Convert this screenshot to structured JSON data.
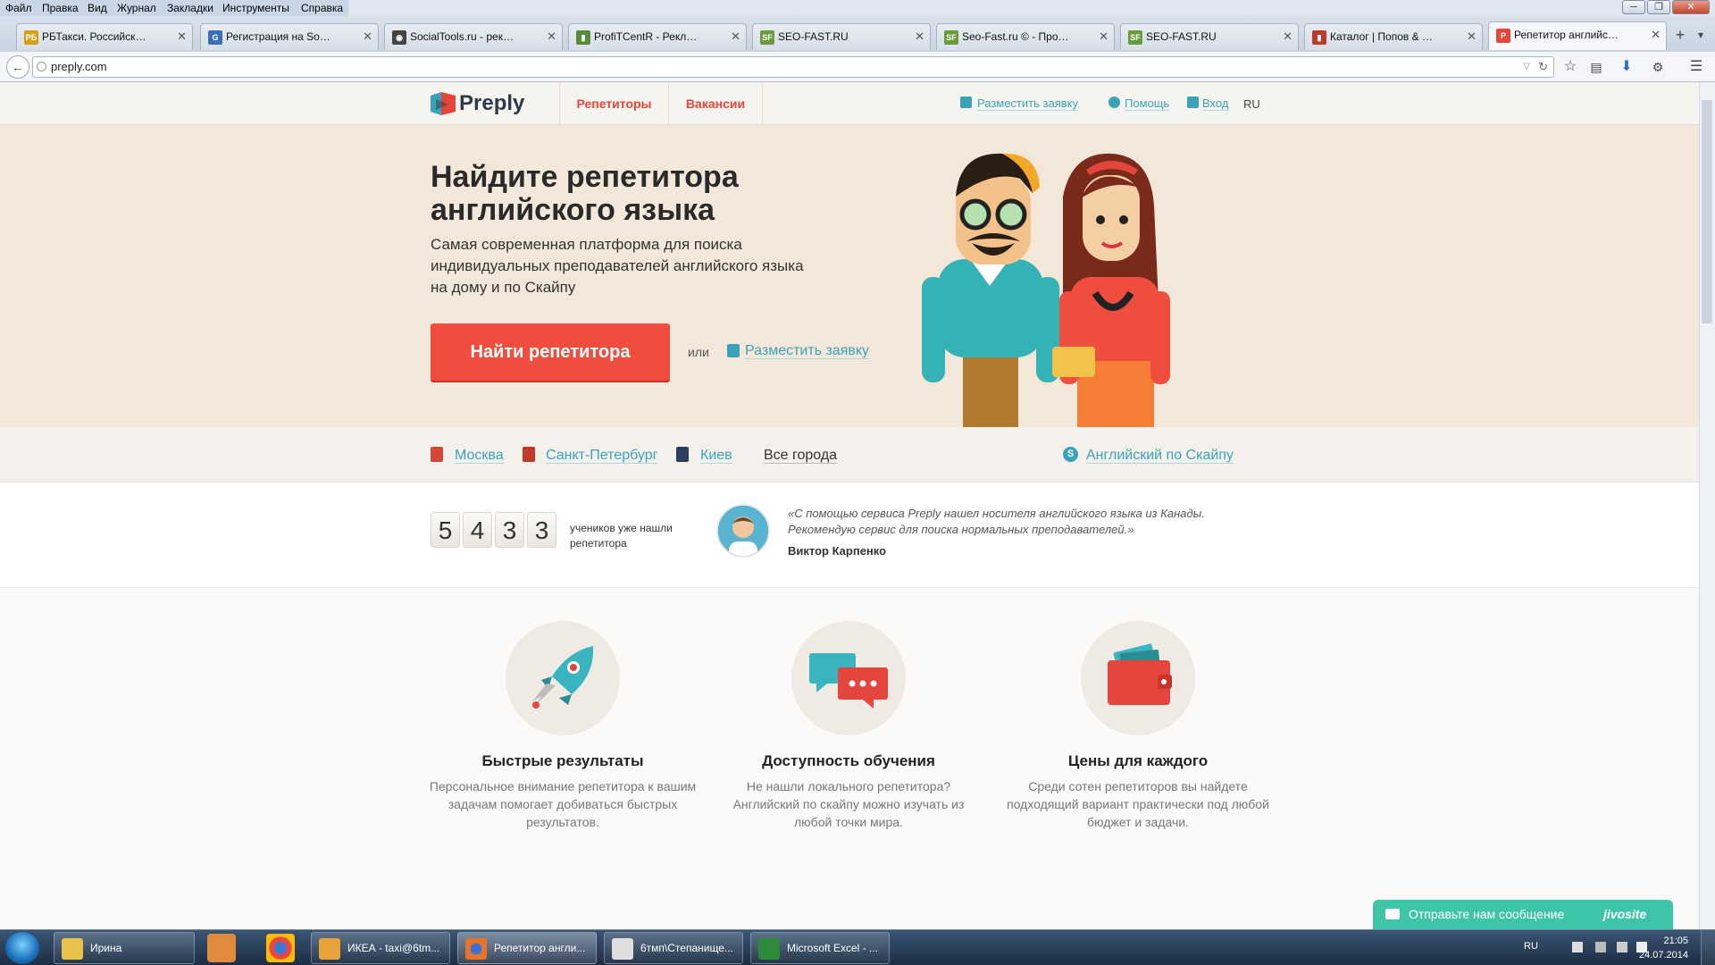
{
  "browser": {
    "menu": [
      "Файл",
      "Правка",
      "Вид",
      "Журнал",
      "Закладки",
      "Инструменты",
      "Справка"
    ],
    "tabs": [
      {
        "title": "РБТакси. Российская Би...",
        "color": "#d4a017",
        "fav": "РБ"
      },
      {
        "title": "Регистрация на SocialTo...",
        "color": "#3b6fb6",
        "fav": "G"
      },
      {
        "title": "SocialTools.ru - реклама ...",
        "color": "#444",
        "fav": "◉"
      },
      {
        "title": "ProfiTCentR - Рекламное ...",
        "color": "#5a8a3a",
        "fav": "▮"
      },
      {
        "title": "SEO-FAST.RU",
        "color": "#6a9b3a",
        "fav": "SF"
      },
      {
        "title": "Seo-Fast.ru © - Просмот...",
        "color": "#6a9b3a",
        "fav": "SF"
      },
      {
        "title": "SEO-FAST.RU",
        "color": "#6a9b3a",
        "fav": "SF"
      },
      {
        "title": "Каталог | Попов & Партн...",
        "color": "#c0392b",
        "fav": "▮"
      },
      {
        "title": "Репетитор английского я...",
        "color": "#e4463d",
        "fav": "P"
      }
    ],
    "url": "preply.com"
  },
  "site": {
    "logo": "Preply",
    "nav": {
      "tutors": "Репетиторы",
      "jobs": "Вакансии"
    },
    "header_links": {
      "post": "Разместить заявку",
      "help": "Помощь",
      "login": "Вход",
      "lang": "RU"
    },
    "hero": {
      "title": "Найдите репетитора английского языка",
      "subtitle": "Самая современная платформа для поиска индивидуальных преподавателей английского языка на дому и по Скайпу",
      "cta": "Найти репетитора",
      "or": "или",
      "post_link": "Разместить заявку"
    },
    "cities": [
      "Москва",
      "Санкт-Петербург",
      "Киев"
    ],
    "all_cities": "Все города",
    "skype_link": "Английский по Скайпу",
    "stats": {
      "digits": [
        "5",
        "4",
        "3",
        "3"
      ],
      "label": "учеников уже нашли репетитора"
    },
    "testimonial": {
      "quote": "«С помощью сервиса Preply нашел носителя английского языка из Канады. Рекомендую сервис для поиска нормальных преподавателей.»",
      "author": "Виктор Карпенко"
    },
    "features": [
      {
        "title": "Быстрые результаты",
        "desc": "Персональное внимание репетитора к вашим задачам помогает добиваться быстрых результатов.",
        "icon": "rocket-icon"
      },
      {
        "title": "Доступность обучения",
        "desc": "Не нашли локального репетитора? Английский по скайпу можно изучать из любой точки мира.",
        "icon": "chat-bubbles-icon"
      },
      {
        "title": "Цены для каждого",
        "desc": "Среди сотен репетиторов вы найдете подходящий вариант практически под любой бюджет и задачи.",
        "icon": "wallet-icon"
      }
    ],
    "jivo": {
      "text": "Отправьте нам сообщение",
      "brand": "jivosite"
    }
  },
  "taskbar": {
    "items": [
      {
        "label": "Ирина",
        "color": "#e8c24a"
      },
      {
        "label": "ИКЕА - taxi@6tm...",
        "color": "#e8a23a"
      },
      {
        "label": "Репетитор англи...",
        "color": "#e8742a"
      },
      {
        "label": "6тмп\\Степанище...",
        "color": "#ddd"
      },
      {
        "label": "Microsoft Excel - ...",
        "color": "#2e8b3a"
      }
    ],
    "lang": "RU",
    "time": "21:05",
    "date": "24.07.2014"
  }
}
